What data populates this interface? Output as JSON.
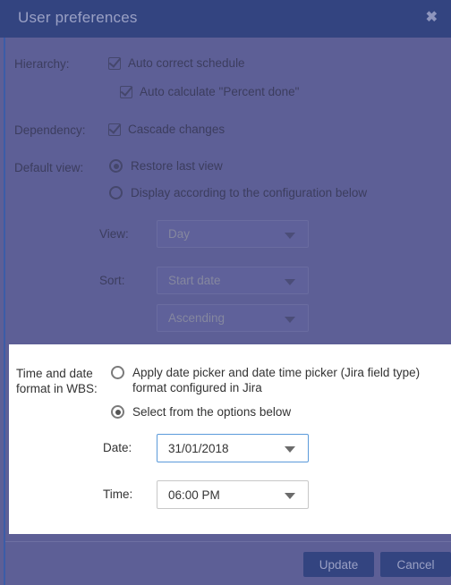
{
  "dialog": {
    "title": "User preferences",
    "close_icon": "close-icon",
    "close_glyph": "✖"
  },
  "colors": {
    "titlebar": "#334480",
    "body": "#5d5f96",
    "accent_line": "#3b5ca8",
    "panel_highlight": "#ffffff",
    "button": "#334480",
    "button_text": "#9aa0c4",
    "focus_border": "#5b9ada"
  },
  "form": {
    "hierarchy": {
      "label": "Hierarchy:",
      "options": [
        {
          "label": "Auto correct schedule",
          "checked": true
        },
        {
          "label": "Auto calculate \"Percent done\"",
          "checked": true
        }
      ]
    },
    "dependency": {
      "label": "Dependency:",
      "options": [
        {
          "label": "Cascade changes",
          "checked": true
        }
      ]
    },
    "default_view": {
      "label": "Default view:",
      "options": [
        {
          "label": "Restore last view",
          "selected": true
        },
        {
          "label": "Display according to the configuration below",
          "selected": false
        }
      ],
      "view": {
        "label": "View:",
        "value": "Day",
        "disabled": true
      },
      "sort": {
        "label": "Sort:",
        "value": "Start date",
        "disabled": true
      },
      "sort_direction": {
        "value": "Ascending",
        "disabled": true
      }
    },
    "time_date_format": {
      "label_line1": "Time and date",
      "label_line2": "format in WBS:",
      "options": [
        {
          "line1": "Apply date picker and date time picker (Jira field type)",
          "line2": "format configured in Jira",
          "selected": false
        },
        {
          "line1": "Select from the options below",
          "line2": "",
          "selected": true
        }
      ],
      "date": {
        "label": "Date:",
        "value": "31/01/2018",
        "focused": true
      },
      "time": {
        "label": "Time:",
        "value": "06:00 PM",
        "focused": false
      }
    }
  },
  "footer": {
    "update_label": "Update",
    "cancel_label": "Cancel"
  }
}
